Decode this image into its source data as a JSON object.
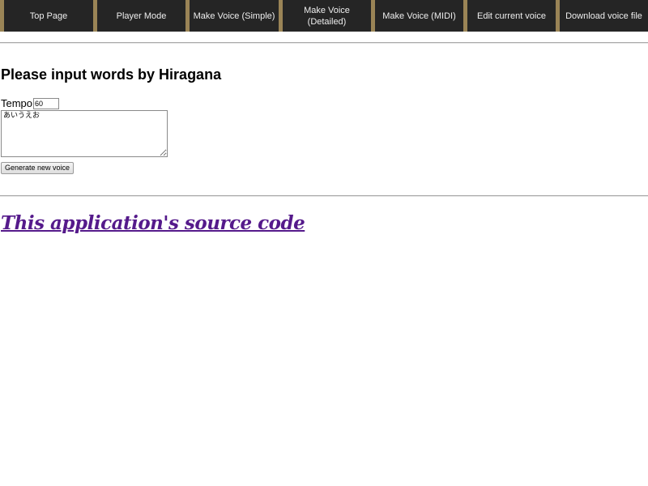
{
  "nav": {
    "items": [
      {
        "label": "Top Page"
      },
      {
        "label": "Player Mode"
      },
      {
        "label": "Make Voice (Simple)"
      },
      {
        "label": "Make Voice\n(Detailed)"
      },
      {
        "label": "Make Voice (MIDI)"
      },
      {
        "label": "Edit current voice"
      },
      {
        "label": "Download voice file"
      }
    ]
  },
  "main": {
    "title": "Please input words by Hiragana",
    "tempo_label": "Tempo:",
    "tempo_value": "60",
    "lyrics_value": "あいうえお",
    "generate_label": "Generate new voice"
  },
  "footer": {
    "source_link": "This application's source code"
  },
  "colors": {
    "nav_background": "#252525",
    "nav_divider": "#9a8456",
    "link": "#551a8b"
  }
}
